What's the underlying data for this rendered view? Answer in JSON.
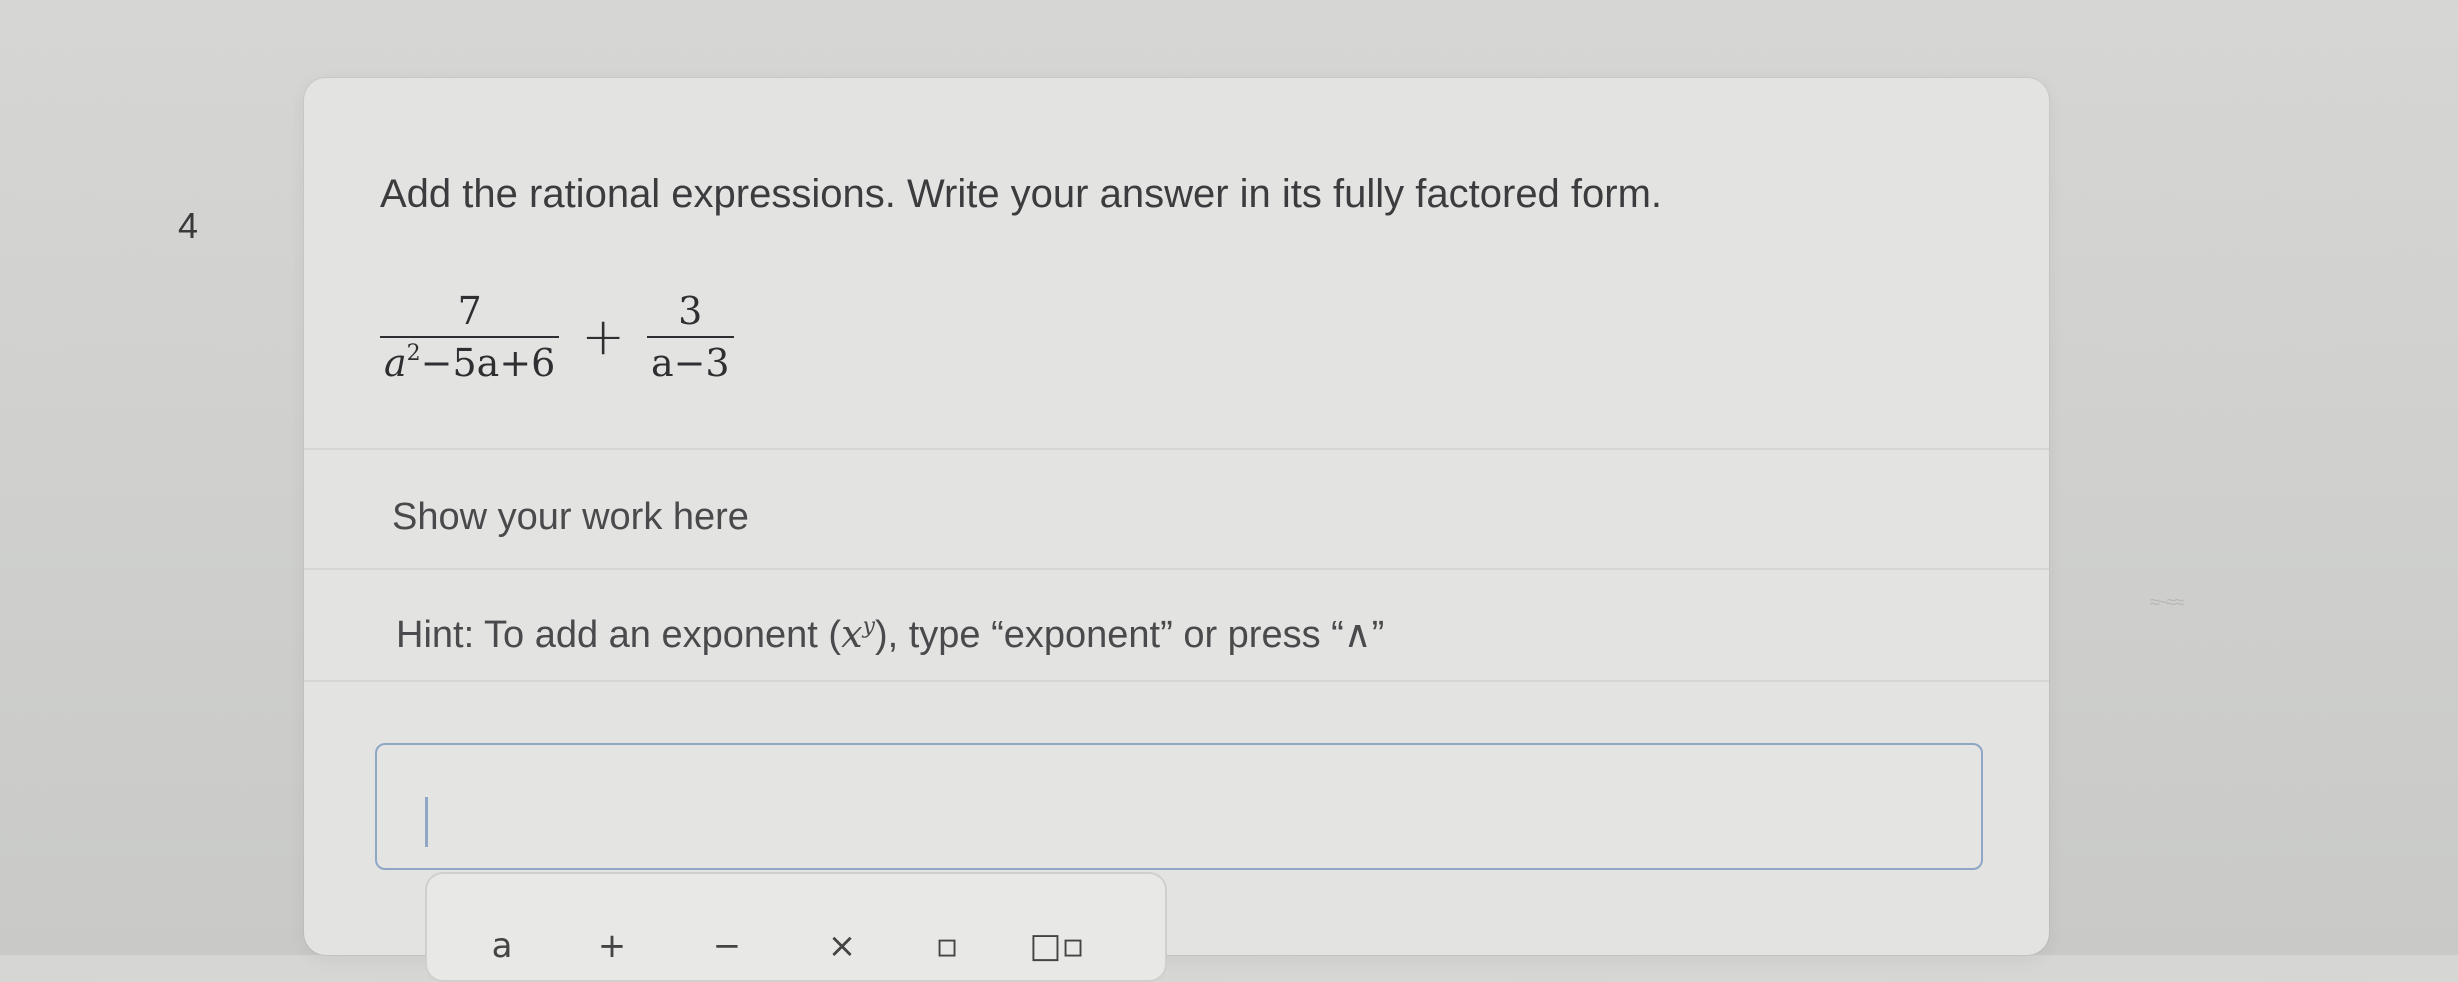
{
  "question": {
    "number": "4",
    "prompt": "Add the rational expressions. Write your answer in its fully factored form.",
    "expression": {
      "frac1_num": "7",
      "frac1_den_a": "a",
      "frac1_den_exp": "2",
      "frac1_den_rest": "−5a+6",
      "operator": "+",
      "frac2_num": "3",
      "frac2_den": "a−3"
    }
  },
  "work_section": {
    "label": "Show your work here",
    "hint_prefix": "Hint: To add an exponent (",
    "hint_base": "x",
    "hint_exp": "y",
    "hint_suffix": "), type “exponent” or press “∧”"
  },
  "answer_input": {
    "value": ""
  },
  "toolbar": {
    "buttons": [
      "a",
      "+",
      "−",
      "×",
      "▫",
      "□▫"
    ]
  },
  "colors": {
    "background": "#d6d6d4",
    "card": "#e3e3e1",
    "input_border": "#8ea7c6",
    "text": "#3c3c3e"
  }
}
